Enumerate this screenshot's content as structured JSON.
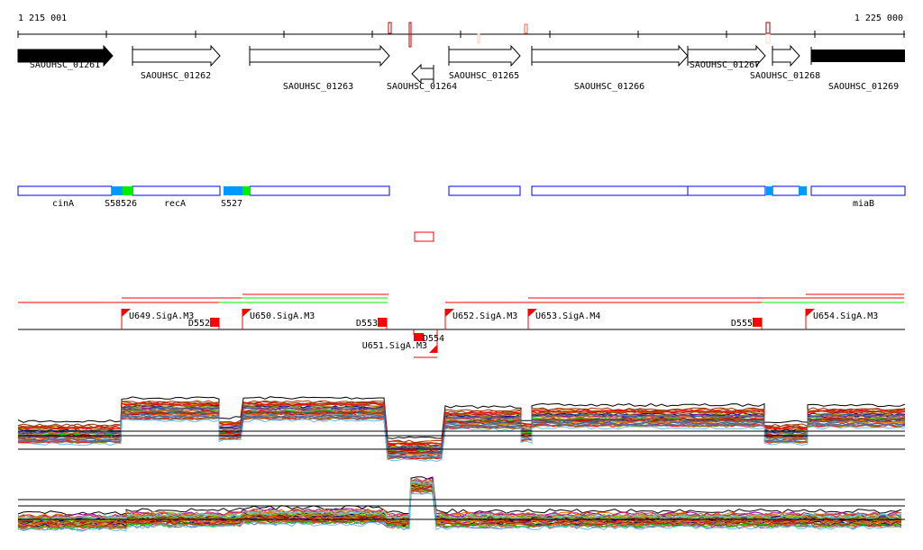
{
  "ruler": {
    "start_label": "1 215 001",
    "end_label": "1 225 000"
  },
  "genes": [
    {
      "name": "SAOUHSC_01261",
      "strand": "+",
      "filled": true
    },
    {
      "name": "SAOUHSC_01262",
      "strand": "+",
      "filled": false
    },
    {
      "name": "SAOUHSC_01263",
      "strand": "+",
      "filled": false
    },
    {
      "name": "SAOUHSC_01264",
      "strand": "-",
      "filled": false
    },
    {
      "name": "SAOUHSC_01265",
      "strand": "+",
      "filled": false
    },
    {
      "name": "SAOUHSC_01266",
      "strand": "+",
      "filled": false
    },
    {
      "name": "SAOUHSC_01267",
      "strand": "+",
      "filled": false
    },
    {
      "name": "SAOUHSC_01268",
      "strand": "+",
      "filled": false
    },
    {
      "name": "SAOUHSC_01269",
      "strand": "+",
      "filled": true
    }
  ],
  "annotations": {
    "labels": [
      "cinA",
      "S58526",
      "recA",
      "S527",
      "miaB"
    ]
  },
  "promoters_terminators": {
    "up": [
      "U649.SigA.M3",
      "U650.SigA.M3",
      "U651.SigA.M3",
      "U652.SigA.M3",
      "U653.SigA.M4",
      "U654.SigA.M3"
    ],
    "down": [
      "D552",
      "D553",
      "D554",
      "D555"
    ]
  },
  "colors": {
    "operon_outline": "#0000ff",
    "segment_blue": "#0099ff",
    "segment_green": "#00ee00",
    "feature_red": "#ff0000",
    "axis": "#000000"
  }
}
